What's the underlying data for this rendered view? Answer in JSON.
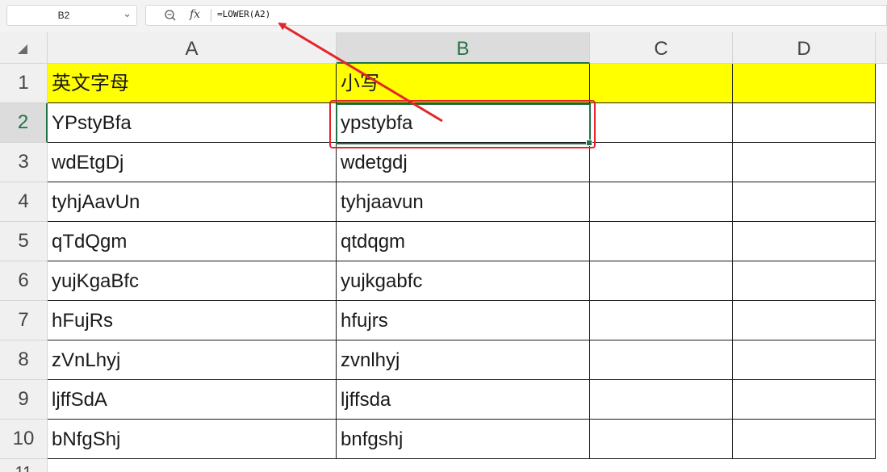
{
  "formula_bar": {
    "cell_reference": "B2",
    "fx_label": "fx",
    "formula": "=LOWER(A2)"
  },
  "columns": [
    "A",
    "B",
    "C",
    "D"
  ],
  "selected_column": "B",
  "rows": [
    "1",
    "2",
    "3",
    "4",
    "5",
    "6",
    "7",
    "8",
    "9",
    "10",
    "11"
  ],
  "selected_row": "2",
  "sheet": {
    "header_row": [
      "英文字母",
      "小写",
      "",
      ""
    ],
    "data_rows": [
      [
        "YPstyBfa",
        "ypstybfa"
      ],
      [
        "wdEtgDj",
        "wdetgdj"
      ],
      [
        "tyhjAavUn",
        "tyhjaavun"
      ],
      [
        "qTdQgm",
        "qtdqgm"
      ],
      [
        "yujKgaBfc",
        "yujkgabfc"
      ],
      [
        "hFujRs",
        "hfujrs"
      ],
      [
        "zVnLhyj",
        "zvnlhyj"
      ],
      [
        "ljffSdA",
        "ljffsda"
      ],
      [
        "bNfgShj",
        "bnfgshj"
      ]
    ]
  },
  "colors": {
    "header_fill": "#ffff00",
    "selection": "#217346",
    "annotation": "#e3262b"
  }
}
